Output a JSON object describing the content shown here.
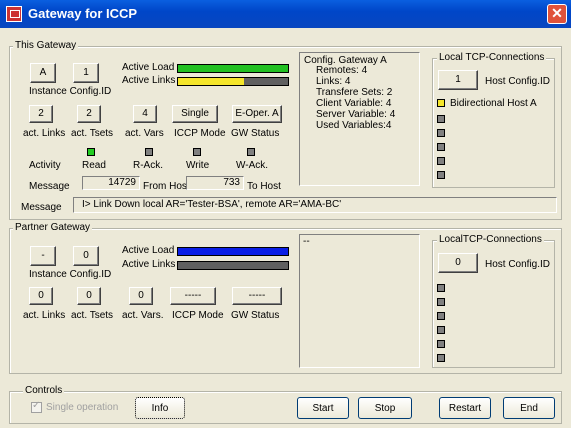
{
  "window": {
    "title": "Gateway for ICCP",
    "close_glyph": "✕"
  },
  "this_gateway": {
    "legend": "This Gateway",
    "instance": "A",
    "config_id": "1",
    "instance_label": "Instance Config.ID",
    "active_load_label": "Active Load",
    "active_links_label": "Active Links",
    "active_load_fraction": 1.0,
    "active_links_fraction": 0.6,
    "act_links": "2",
    "act_tsets": "2",
    "act_vars": "4",
    "iccp_mode": "Single",
    "gw_status": "E-Oper. A",
    "col_labels": [
      "act. Links",
      "act. Tsets",
      "act. Vars",
      "ICCP Mode",
      "GW Status"
    ],
    "activity_label": "Activity",
    "activity": [
      {
        "label": "Read",
        "color": "#22cc22"
      },
      {
        "label": "R-Ack.",
        "color": "#808080"
      },
      {
        "label": "Write",
        "color": "#808080"
      },
      {
        "label": "W-Ack.",
        "color": "#808080"
      }
    ],
    "message_label": "Message",
    "from_host_value": "14729",
    "from_host_label": "From Host",
    "to_host_value": "733",
    "to_host_label": "To Host",
    "message_text": "I> Link Down local AR='Tester-BSA', remote AR='AMA-BC'",
    "config_lines": [
      "Config. Gateway  A",
      "Remotes:            4",
      "Links:                  4",
      "Transfere Sets:   2",
      "Client Variable:   4",
      "Server Variable:  4",
      "Used Variables:4"
    ],
    "tcp": {
      "legend": "Local TCP-Connections",
      "host_config_value": "1",
      "host_config_label": "Host Config.ID",
      "items": [
        {
          "label": "Bidirectional Host A",
          "color": "#f5e62a"
        },
        {
          "label": "",
          "color": "#808080"
        },
        {
          "label": "",
          "color": "#808080"
        },
        {
          "label": "",
          "color": "#808080"
        },
        {
          "label": "",
          "color": "#808080"
        },
        {
          "label": "",
          "color": "#808080"
        }
      ]
    }
  },
  "partner_gateway": {
    "legend": "Partner Gateway",
    "instance": "-",
    "config_id": "0",
    "instance_label": "Instance Config.ID",
    "active_load_label": "Active Load",
    "active_links_label": "Active Links",
    "active_load_fraction": 1.0,
    "active_links_fraction": 0.0,
    "act_links": "0",
    "act_tsets": "0",
    "act_vars": "0",
    "iccp_mode": "-----",
    "gw_status": "-----",
    "col_labels": [
      "act. Links",
      "act. Tsets",
      "act. Vars.",
      "ICCP Mode",
      "GW Status"
    ],
    "config_text": "--",
    "tcp": {
      "legend": "LocalTCP-Connections",
      "host_config_value": "0",
      "host_config_label": "Host Config.ID",
      "items": 6
    }
  },
  "controls": {
    "legend": "Controls",
    "single_operation_label": "Single operation",
    "single_operation_checked": true,
    "info_label": "Info",
    "start_label": "Start",
    "stop_label": "Stop",
    "restart_label": "Restart",
    "end_label": "End"
  },
  "colors": {
    "load_green": "#22c022",
    "links_yellow": "#f5e62a",
    "load_blue": "#0a1ee6",
    "bar_gray": "#606060"
  }
}
